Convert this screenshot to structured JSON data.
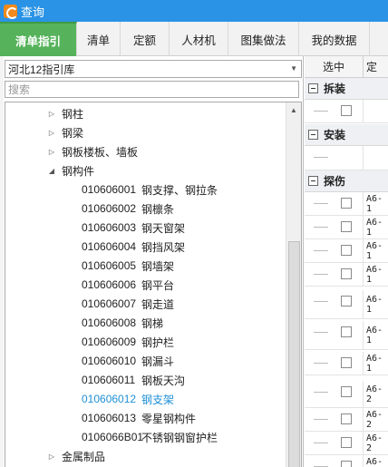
{
  "window": {
    "title": "查询"
  },
  "tabs": [
    {
      "label": "清单指引",
      "active": true
    },
    {
      "label": "清单",
      "active": false
    },
    {
      "label": "定额",
      "active": false
    },
    {
      "label": "人材机",
      "active": false
    },
    {
      "label": "图集做法",
      "active": false
    },
    {
      "label": "我的数据",
      "active": false
    }
  ],
  "library": {
    "selected": "河北12指引库"
  },
  "search": {
    "placeholder": "搜索",
    "value": ""
  },
  "tree": {
    "nodes": [
      {
        "label": "钢柱",
        "expander": "collapsed"
      },
      {
        "label": "钢梁",
        "expander": "collapsed"
      },
      {
        "label": "钢板楼板、墙板",
        "expander": "collapsed"
      },
      {
        "label": "钢构件",
        "expander": "expanded"
      },
      {
        "code": "010606001",
        "name": "钢支撑、钢拉条"
      },
      {
        "code": "010606002",
        "name": "钢檩条"
      },
      {
        "code": "010606003",
        "name": "钢天窗架"
      },
      {
        "code": "010606004",
        "name": "钢挡风架"
      },
      {
        "code": "010606005",
        "name": "钢墙架"
      },
      {
        "code": "010606006",
        "name": "钢平台"
      },
      {
        "code": "010606007",
        "name": "钢走道"
      },
      {
        "code": "010606008",
        "name": "钢梯"
      },
      {
        "code": "010606009",
        "name": "钢护栏"
      },
      {
        "code": "010606010",
        "name": "钢漏斗"
      },
      {
        "code": "010606011",
        "name": "钢板天沟"
      },
      {
        "code": "010606012",
        "name": "钢支架",
        "selected": true
      },
      {
        "code": "010606013",
        "name": "零星钢构件"
      },
      {
        "code": "0106066B01",
        "name": "不锈钢钢窗护栏"
      },
      {
        "label": "金属制品",
        "expander": "collapsed"
      }
    ]
  },
  "results": {
    "columns": [
      "选中",
      "定"
    ],
    "groups": [
      {
        "label": "拆装"
      },
      {
        "label": "安装"
      },
      {
        "label": "探伤"
      }
    ],
    "rows": [
      {
        "code": ""
      },
      {
        "code": "A6-1"
      },
      {
        "code": "A6-1"
      },
      {
        "code": "A6-1"
      },
      {
        "code": "A6-1"
      },
      {
        "code": "A6-1"
      },
      {
        "code": "A6-1"
      },
      {
        "code": "A6-1"
      },
      {
        "code": "A6-2"
      },
      {
        "code": "A6-2"
      },
      {
        "code": "A6-2"
      },
      {
        "code": "A6-2"
      }
    ]
  },
  "colors": {
    "titlebar": "#2a93e6",
    "active_tab": "#56b35b",
    "selected_item": "#1e8fd6"
  }
}
